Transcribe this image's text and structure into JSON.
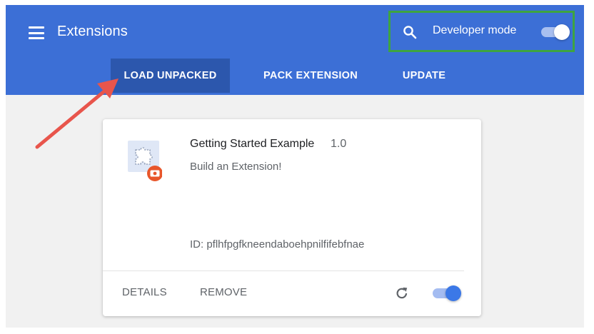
{
  "header": {
    "title": "Extensions",
    "developer_mode_label": "Developer mode",
    "developer_mode_enabled": true
  },
  "toolbar": {
    "load_unpacked": "LOAD UNPACKED",
    "pack_extension": "PACK EXTENSION",
    "update": "UPDATE"
  },
  "extension": {
    "name": "Getting Started Example",
    "version": "1.0",
    "description": "Build an Extension!",
    "id_text": "ID: pflhfpgfkneendaboehpnilfifebfnae",
    "details_label": "DETAILS",
    "remove_label": "REMOVE",
    "enabled": true
  },
  "icons": {
    "menu": "menu-icon",
    "search": "search-icon",
    "extension": "puzzle-piece-icon",
    "badge": "camera-badge-icon",
    "reload": "reload-icon"
  },
  "colors": {
    "header_blue": "#3c6fd6",
    "active_tab": "#2c57ad",
    "highlight_box": "#3ea440",
    "arrow": "#e8554c",
    "toggle_on": "#3b78e7"
  }
}
